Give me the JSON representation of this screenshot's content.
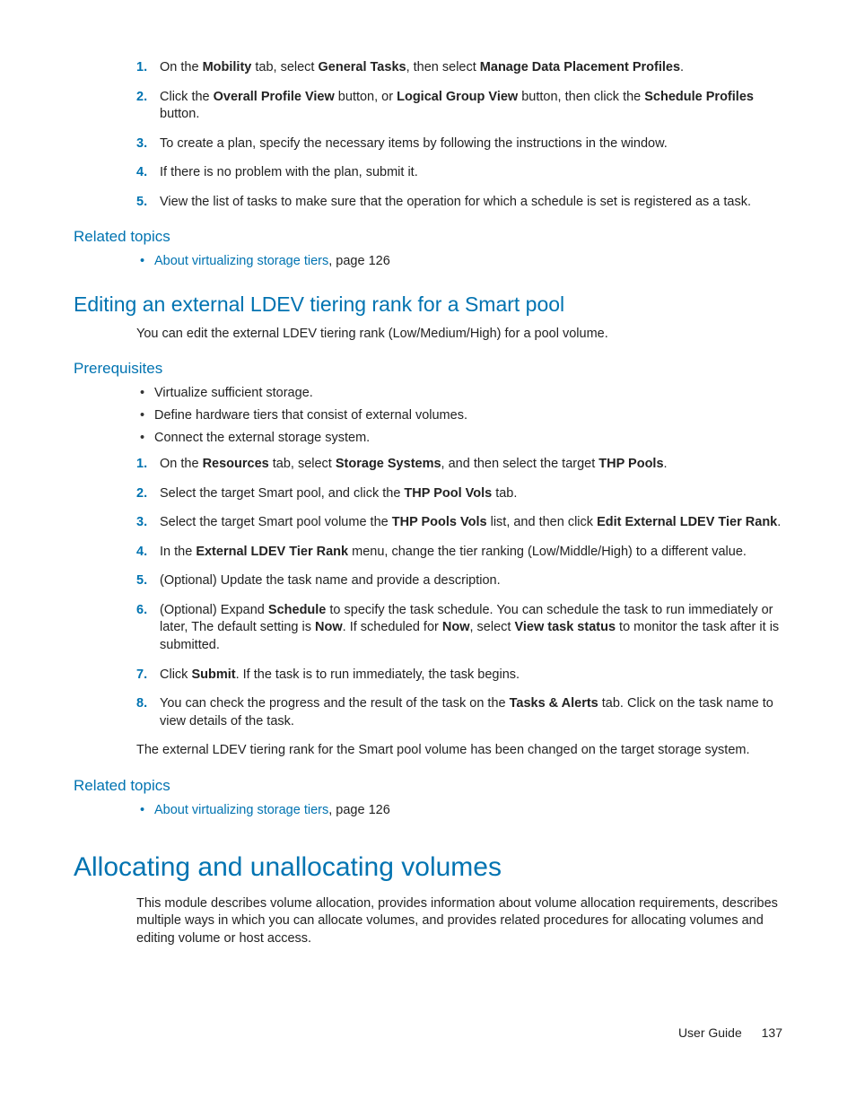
{
  "ol1": {
    "items": [
      {
        "n": "1.",
        "html": "On the <b>Mobility</b> tab, select <b>General Tasks</b>, then select <b>Manage Data Placement Profiles</b>."
      },
      {
        "n": "2.",
        "html": "Click the <b>Overall Profile View</b> button, or <b>Logical Group View</b> button, then click the <b>Schedule Profiles</b> button."
      },
      {
        "n": "3.",
        "html": "To create a plan, specify the necessary items by following the instructions in the window."
      },
      {
        "n": "4.",
        "html": "If there is no problem with the plan, submit it."
      },
      {
        "n": "5.",
        "html": "View the list of tasks to make sure that the operation for which a schedule is set is registered as a task."
      }
    ]
  },
  "related1": {
    "heading": "Related topics",
    "link": "About virtualizing storage tiers",
    "suffix": ", page 126"
  },
  "section2": {
    "heading": "Editing an external LDEV tiering rank for a Smart pool",
    "intro": "You can edit the external LDEV tiering rank (Low/Medium/High) for a pool volume."
  },
  "prereq": {
    "heading": "Prerequisites",
    "bullets": [
      "Virtualize sufficient storage.",
      "Define hardware tiers that consist of external volumes.",
      "Connect the external storage system."
    ]
  },
  "ol2": {
    "items": [
      {
        "n": "1.",
        "html": "On the <b>Resources</b> tab, select <b>Storage Systems</b>, and then select the target <b>THP Pools</b>."
      },
      {
        "n": "2.",
        "html": "Select the target Smart pool, and click the <b>THP Pool Vols</b> tab."
      },
      {
        "n": "3.",
        "html": "Select the target Smart pool volume the <b>THP Pools Vols</b> list, and then click <b>Edit External LDEV Tier Rank</b>."
      },
      {
        "n": "4.",
        "html": "In the <b>External LDEV Tier Rank</b> menu, change the tier ranking (Low/Middle/High) to a different value."
      },
      {
        "n": "5.",
        "html": "(Optional) Update the task name and provide a description."
      },
      {
        "n": "6.",
        "html": "(Optional) Expand <b>Schedule</b> to specify the task schedule. You can schedule the task to run immediately or later, The default setting is <b>Now</b>. If scheduled for <b>Now</b>, select <b>View task status</b> to monitor the task after it is submitted."
      },
      {
        "n": "7.",
        "html": "Click <b>Submit</b>. If the task is to run immediately, the task begins."
      },
      {
        "n": "8.",
        "html": "You can check the progress and the result of the task on the <b>Tasks &amp; Alerts</b> tab. Click on the task name to view details of the task."
      }
    ]
  },
  "result": "The external LDEV tiering rank for the Smart pool volume has been changed on the target storage system.",
  "related2": {
    "heading": "Related topics",
    "link": "About virtualizing storage tiers",
    "suffix": ", page 126"
  },
  "major": {
    "heading": "Allocating and unallocating volumes",
    "intro": "This module describes volume allocation, provides information about volume allocation requirements, describes multiple ways in which you can allocate volumes, and provides related procedures for allocating volumes and editing volume or host access."
  },
  "footer": {
    "label": "User Guide",
    "page": "137"
  }
}
